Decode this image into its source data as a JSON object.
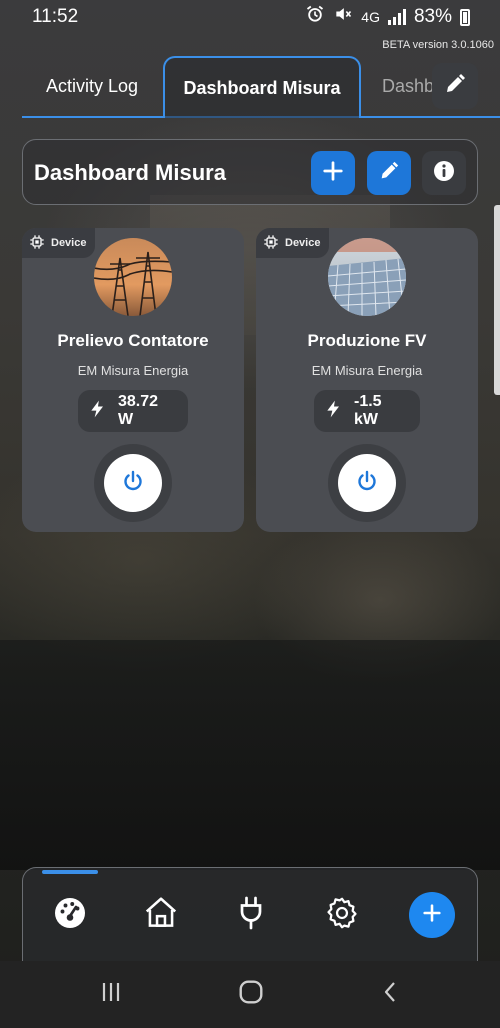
{
  "status_bar": {
    "time": "11:52",
    "network": "4G",
    "battery": "83%"
  },
  "beta_label": "BETA version 3.0.1060",
  "tabs": [
    {
      "label": "Activity Log"
    },
    {
      "label": "Dashboard Misura"
    },
    {
      "label": "Dashb"
    }
  ],
  "header": {
    "title": "Dashboard Misura"
  },
  "devices": [
    {
      "badge": "Device",
      "name": "Prelievo Contatore",
      "subtitle": "EM Misura Energia",
      "reading": "38.72 W",
      "power_state": "on"
    },
    {
      "badge": "Device",
      "name": "Produzione FV",
      "subtitle": "EM Misura Energia",
      "reading": "-1.5 kW",
      "power_state": "on"
    }
  ],
  "icons": {
    "tab_edit": "pencil-icon",
    "header_add": "plus-icon",
    "header_edit": "pencil-icon",
    "header_info": "info-icon",
    "device_badge": "chip-icon",
    "reading": "lightning-icon",
    "power": "power-icon",
    "nav": [
      "dashboard-gauge-icon",
      "home-icon",
      "plug-icon",
      "gear-icon",
      "plus-icon"
    ],
    "system": [
      "recents-icon",
      "home-circle-icon",
      "back-icon"
    ]
  },
  "colors": {
    "accent": "#1e77d9",
    "accent_light": "#3b8fe8",
    "card": "#4b4d52",
    "power_icon": "#1e77d9"
  }
}
